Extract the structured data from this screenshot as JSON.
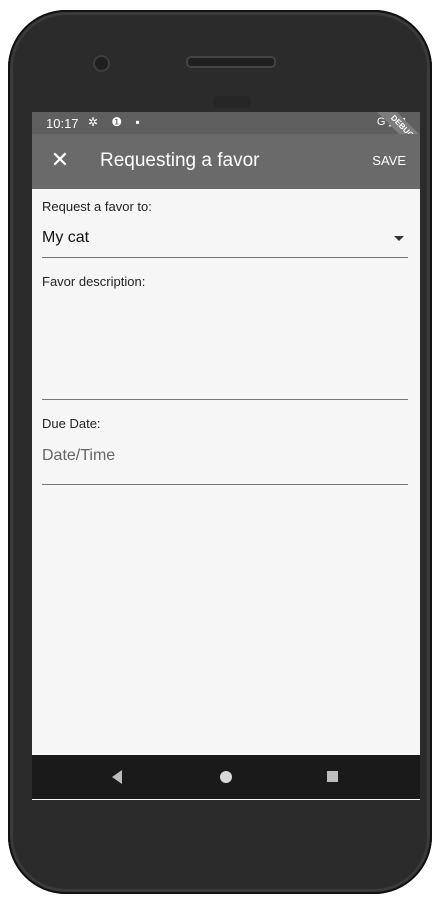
{
  "status_bar": {
    "time": "10:17",
    "icons": "✲ ❶ ▪",
    "right": "G ◢ ▮",
    "debug_banner": "DEBUG"
  },
  "app_bar": {
    "close_icon": "close-icon",
    "close_glyph": "✕",
    "title": "Requesting a favor",
    "save_label": "SAVE"
  },
  "form": {
    "request_label": "Request a favor to:",
    "request_value": "My cat",
    "description_label": "Favor description:",
    "description_value": "",
    "due_label": "Due Date:",
    "due_placeholder": "Date/Time"
  },
  "colors": {
    "app_bar": "#6a6a6a",
    "status_bar": "#5f5f5f",
    "screen_bg": "#f6f6f6"
  }
}
